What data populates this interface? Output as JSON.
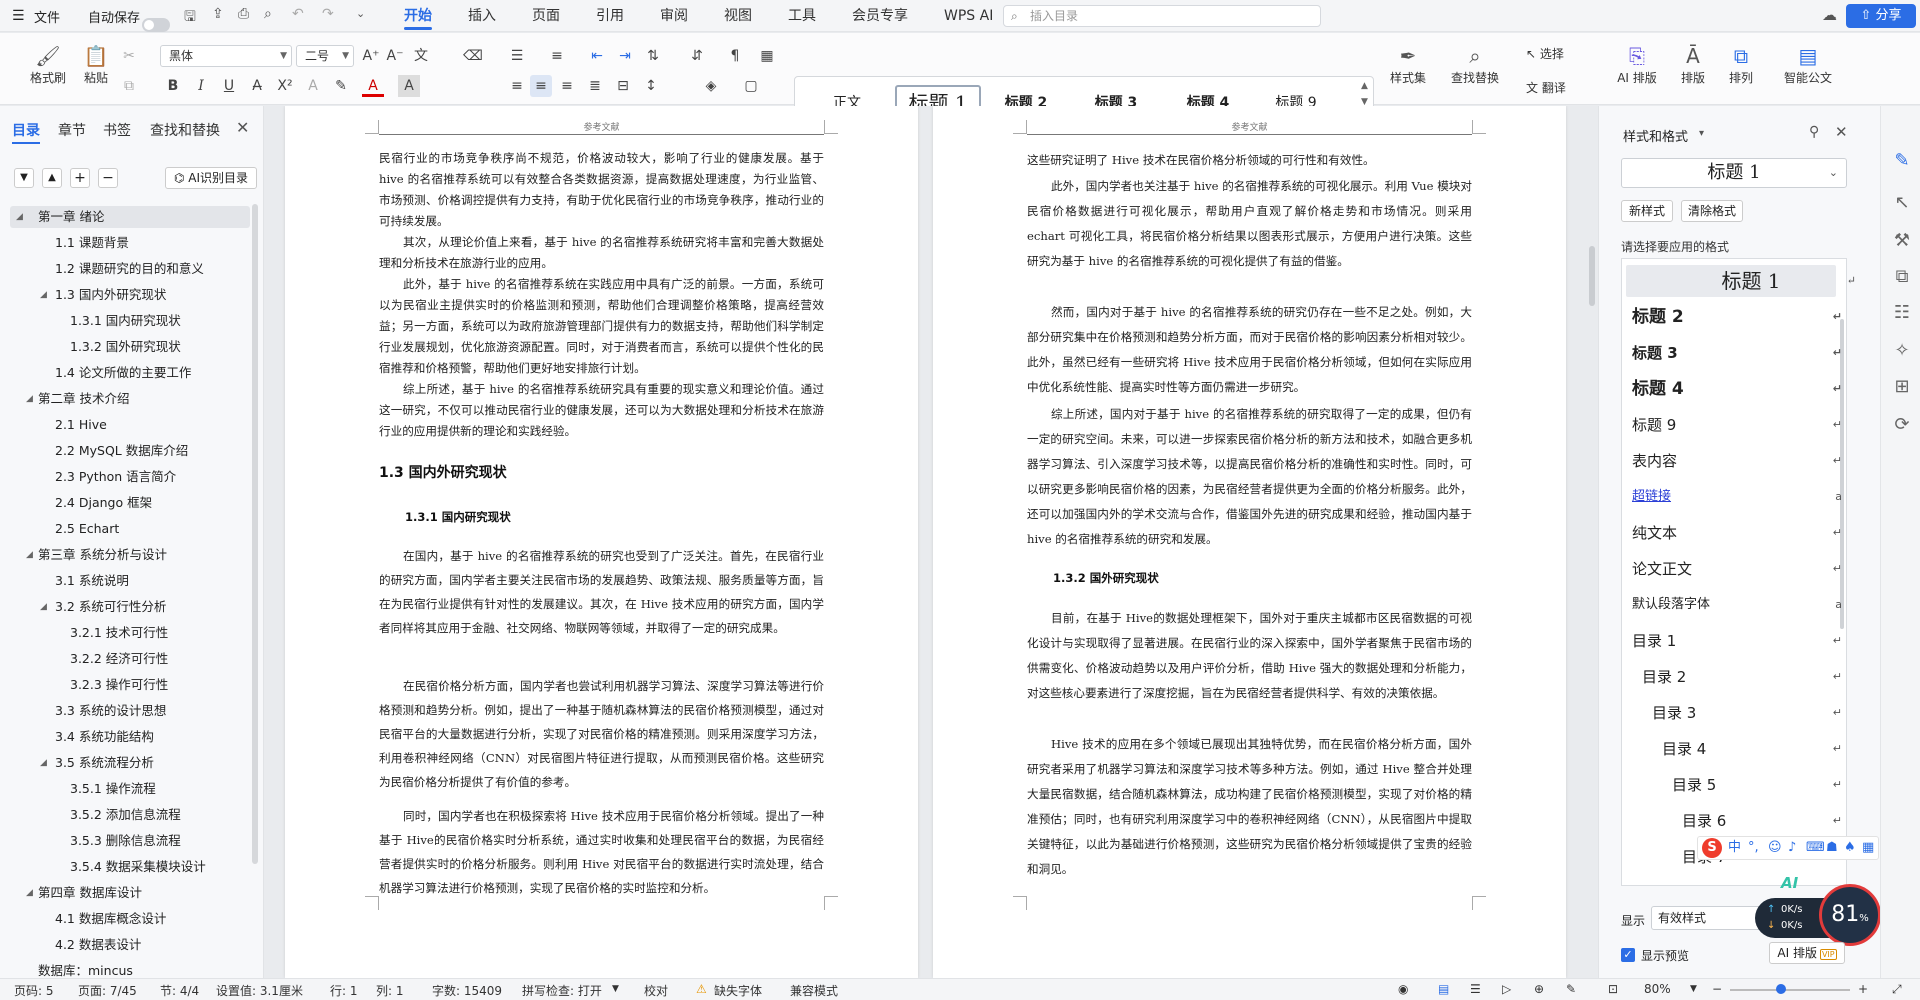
{
  "menubar": {
    "file": "文件",
    "autosave": "自动保存",
    "tabs": [
      "开始",
      "插入",
      "页面",
      "引用",
      "审阅",
      "视图",
      "工具",
      "会员专享",
      "WPS AI"
    ],
    "search_placeholder": "插入目录",
    "share": "分享"
  },
  "ribbon": {
    "format_painter": "格式刷",
    "paste": "粘贴",
    "font": "黑体",
    "size": "二号",
    "bold": "B",
    "italic": "I",
    "underline": "U",
    "styles": [
      "正文",
      "标题 1",
      "标题 2",
      "标题 3",
      "标题 4",
      "标题 9"
    ],
    "style_set": "样式集",
    "find_replace": "查找替换",
    "select": "选择",
    "translate": "翻译",
    "ai_layout": "AI 排版",
    "layout": "排版",
    "arrange": "排列",
    "smart_doc": "智能公文"
  },
  "leftpanel": {
    "tabs": [
      "目录",
      "章节",
      "书签",
      "查找和替换"
    ],
    "ai_toc": "AI识别目录",
    "toc": [
      "第一章  绪论",
      "1.1 课题背景",
      "1.2 课题研究的目的和意义",
      "1.3  国内外研究现状",
      "1.3.1  国内研究现状",
      "1.3.2  国外研究现状",
      "1.4 论文所做的主要工作",
      "第二章  技术介绍",
      "2.1 Hive",
      "2.2 MySQL 数据库介绍",
      "2.3 Python 语言简介",
      "2.4 Django 框架",
      "2.5 Echart",
      "第三章  系统分析与设计",
      "3.1 系统说明",
      "3.2 系统可行性分析",
      "3.2.1  技术可行性",
      "3.2.2  经济可行性",
      "3.2.3  操作可行性",
      "3.3 系统的设计思想",
      "3.4 系统功能结构",
      "3.5 系统流程分析",
      "3.5.1 操作流程",
      "3.5.2 添加信息流程",
      "3.5.3 删除信息流程",
      "3.5.4 数据采集模块设计",
      "第四章  数据库设计",
      "4.1 数据库概念设计",
      "4.2 数据表设计",
      "数据库：mincus"
    ]
  },
  "page1": {
    "header": "参考文献",
    "p": [
      "民宿行业的市场竞争秩序尚不规范，价格波动较大，影响了行业的健康发展。基于 hive 的名宿推荐系统可以有效整合各类数据资源，提高数据处理速度，为行业监管、市场预测、价格调控提供有力支持，有助于优化民宿行业的市场竞争秩序，推动行业的可持续发展。",
      "其次，从理论价值上来看，基于 hive 的名宿推荐系统研究将丰富和完善大数据处理和分析技术在旅游行业的应用。",
      "此外，基于 hive 的名宿推荐系统在实践应用中具有广泛的前景。一方面，系统可以为民宿业主提供实时的价格监测和预测，帮助他们合理调整价格策略，提高经营效益；另一方面，系统可以为政府旅游管理部门提供有力的数据支持，帮助他们科学制定行业发展规划，优化旅游资源配置。同时，对于消费者而言，系统可以提供个性化的民宿推荐和价格预警，帮助他们更好地安排旅行计划。",
      "综上所述，基于 hive 的名宿推荐系统研究具有重要的现实意义和理论价值。通过这一研究，不仅可以推动民宿行业的健康发展，还可以为大数据处理和分析技术在旅游行业的应用提供新的理论和实践经验。"
    ],
    "h2": "1.3  国内外研究现状",
    "h3": "1.3.1  国内研究现状",
    "p2": [
      "在国内，基于 hive 的名宿推荐系统的研究也受到了广泛关注。首先，在民宿行业的研究方面，国内学者主要关注民宿市场的发展趋势、政策法规、服务质量等方面，旨在为民宿行业提供有针对性的发展建议。其次，在 Hive 技术应用的研究方面，国内学者同样将其应用于金融、社交网络、物联网等领域，并取得了一定的研究成果。",
      "在民宿价格分析方面，国内学者也尝试利用机器学习算法、深度学习算法等进行价格预测和趋势分析。例如，提出了一种基于随机森林算法的民宿价格预测模型，通过对民宿平台的大量数据进行分析，实现了对民宿价格的精准预测。则采用深度学习方法，利用卷积神经网络（CNN）对民宿图片特征进行提取，从而预测民宿价格。这些研究为民宿价格分析提供了有价值的参考。",
      "同时，国内学者也在积极探索将 Hive 技术应用于民宿价格分析领域。提出了一种基于 Hive的民宿价格实时分析系统，通过实时收集和处理民宿平台的数据，为民宿经营者提供实时的价格分析服务。则利用 Hive 对民宿平台的数据进行实时流处理，结合机器学习算法进行价格预测，实现了民宿价格的实时监控和分析。"
    ]
  },
  "page2": {
    "header": "参考文献",
    "p": [
      "这些研究证明了 Hive 技术在民宿价格分析领域的可行性和有效性。",
      "此外，国内学者也关注基于 hive 的名宿推荐系统的可视化展示。利用 Vue 模块对民宿价格数据进行可视化展示，帮助用户直观了解价格走势和市场情况。则采用 echart 可视化工具，将民宿价格分析结果以图表形式展示，方便用户进行决策。这些研究为基于 hive 的名宿推荐系统的可视化提供了有益的借鉴。",
      "然而，国内对于基于 hive 的名宿推荐系统的研究仍存在一些不足之处。例如，大部分研究集中在价格预测和趋势分析方面，而对于民宿价格的影响因素分析相对较少。此外，虽然已经有一些研究将 Hive 技术应用于民宿价格分析领域，但如何在实际应用中优化系统性能、提高实时性等方面仍需进一步研究。",
      "综上所述，国内对于基于 hive 的名宿推荐系统的研究取得了一定的成果，但仍有一定的研究空间。未来，可以进一步探索民宿价格分析的新方法和技术，如融合更多机器学习算法、引入深度学习技术等，以提高民宿价格分析的准确性和实时性。同时，可以研究更多影响民宿价格的因素，为民宿经营者提供更为全面的价格分析服务。此外，还可以加强国内外的学术交流与合作，借鉴国外先进的研究成果和经验，推动国内基于 hive 的名宿推荐系统的研究和发展。"
    ],
    "h3": "1.3.2  国外研究现状",
    "p2": [
      "目前，在基于 Hive的数据处理框架下，国外对于重庆主城都市区民宿数据的可视化设计与实现取得了显著进展。在民宿行业的深入探索中，国外学者聚焦于民宿市场的供需变化、价格波动趋势以及用户评价分析，借助 Hive 强大的数据处理和分析能力，对这些核心要素进行了深度挖掘，旨在为民宿经营者提供科学、有效的决策依据。",
      "Hive 技术的应用在多个领域已展现出其独特优势，而在民宿价格分析方面，国外研究者采用了机器学习算法和深度学习技术等多种方法。例如，通过 Hive 整合并处理大量民宿数据，结合随机森林算法，成功构建了民宿价格预测模型，实现了对价格的精准预估；同时，也有研究利用深度学习中的卷积神经网络（CNN），从民宿图片中提取关键特征，以此为基础进行价格预测，这些研究为民宿价格分析领域提供了宝贵的经验和洞见。"
    ]
  },
  "rightpanel": {
    "title": "样式和格式",
    "current": "标题  1",
    "new_style": "新样式",
    "clear_format": "清除格式",
    "apply_label": "请选择要应用的格式",
    "styles": [
      "标题  1",
      "标题 2",
      "标题  3",
      "标题  4",
      "标题  9",
      "表内容",
      "超链接",
      "纯文本",
      "论文正文",
      "默认段落字体",
      "目录  1",
      "目录  2",
      "目录  3",
      "目录  4",
      "目录  5",
      "目录  6",
      "目录  7"
    ],
    "show_label": "显示",
    "show_value": "有效样式",
    "preview": "显示预览",
    "ai_layout": "AI 排版",
    "net_up": "0K/s",
    "net_down": "0K/s",
    "percent": "81",
    "ime": "中"
  },
  "status": {
    "page": "页码: 5",
    "pages": "页面: 7/45",
    "section": "节: 4/4",
    "setting": "设置值: 3.1厘米",
    "row": "行: 1",
    "col": "列: 1",
    "words": "字数: 15409",
    "spell": "拼写检查: 打开",
    "proof": "校对",
    "missing_font": "缺失字体",
    "compat": "兼容模式",
    "zoom": "80%"
  }
}
